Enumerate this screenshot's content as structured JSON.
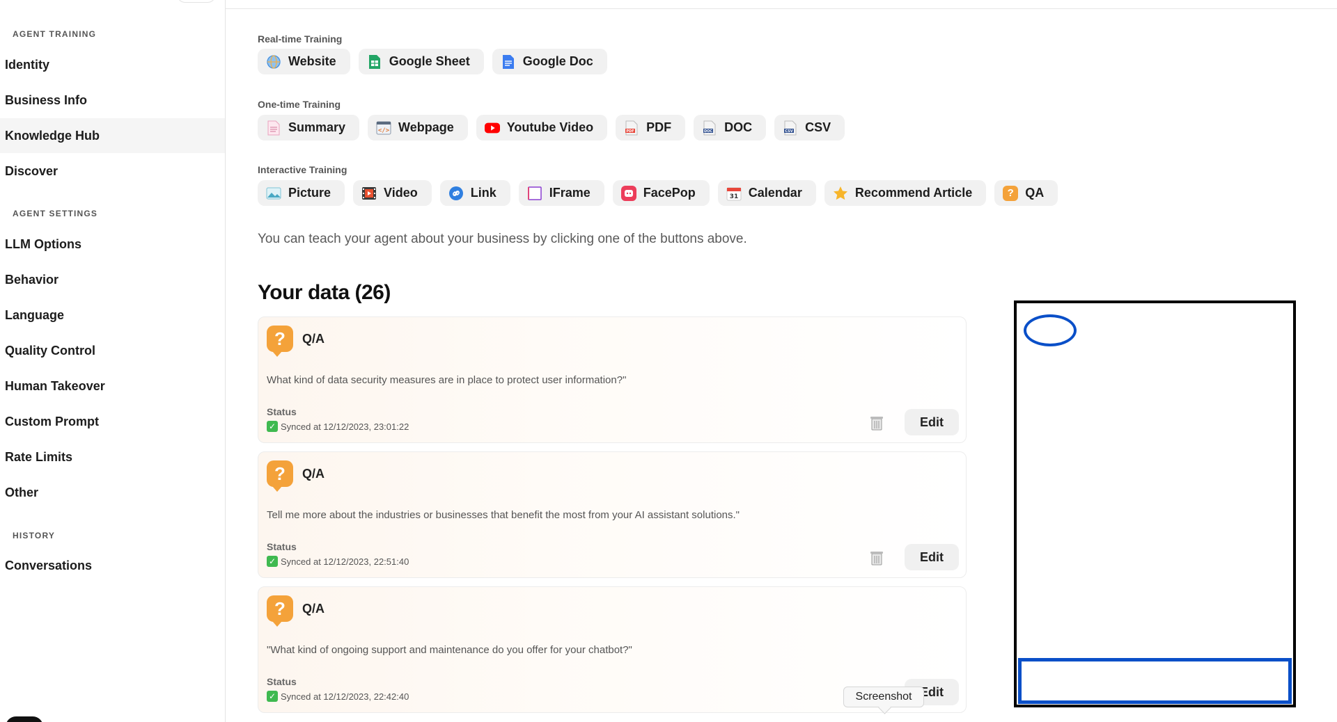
{
  "sidebar": {
    "sections": [
      {
        "title": "AGENT TRAINING",
        "items": [
          "Identity",
          "Business Info",
          "Knowledge Hub",
          "Discover"
        ]
      },
      {
        "title": "AGENT SETTINGS",
        "items": [
          "LLM Options",
          "Behavior",
          "Language",
          "Quality Control",
          "Human Takeover",
          "Custom Prompt",
          "Rate Limits",
          "Other"
        ]
      },
      {
        "title": "HISTORY",
        "items": [
          "Conversations"
        ]
      }
    ],
    "active_item": "Knowledge Hub"
  },
  "training": {
    "realtime": {
      "title": "Real-time Training",
      "chips": [
        {
          "label": "Website",
          "icon": "globe-icon"
        },
        {
          "label": "Google Sheet",
          "icon": "google-sheet-icon"
        },
        {
          "label": "Google Doc",
          "icon": "google-doc-icon"
        }
      ]
    },
    "onetime": {
      "title": "One-time Training",
      "chips": [
        {
          "label": "Summary",
          "icon": "summary-icon"
        },
        {
          "label": "Webpage",
          "icon": "webpage-code-icon"
        },
        {
          "label": "Youtube Video",
          "icon": "youtube-icon"
        },
        {
          "label": "PDF",
          "icon": "pdf-file-icon"
        },
        {
          "label": "DOC",
          "icon": "doc-file-icon"
        },
        {
          "label": "CSV",
          "icon": "csv-file-icon"
        }
      ]
    },
    "interactive": {
      "title": "Interactive Training",
      "chips": [
        {
          "label": "Picture",
          "icon": "picture-icon"
        },
        {
          "label": "Video",
          "icon": "film-icon"
        },
        {
          "label": "Link",
          "icon": "link-icon"
        },
        {
          "label": "IFrame",
          "icon": "iframe-icon"
        },
        {
          "label": "FacePop",
          "icon": "facepop-icon"
        },
        {
          "label": "Calendar",
          "icon": "calendar-icon"
        },
        {
          "label": "Recommend Article",
          "icon": "star-icon"
        },
        {
          "label": "QA",
          "icon": "qa-icon"
        }
      ]
    },
    "calendar_day": "31",
    "helper": "You can teach your agent about your business by clicking one of the buttons above."
  },
  "data": {
    "heading": "Your data (26)",
    "status_label": "Status",
    "edit_label": "Edit",
    "badge_glyph": "?",
    "check_glyph": "✓",
    "items": [
      {
        "type": "Q/A",
        "question": "What kind of data security measures are in place to protect user information?\"",
        "status": "Synced at 12/12/2023, 23:01:22"
      },
      {
        "type": "Q/A",
        "question": "Tell me more about the industries or businesses that benefit the most from your AI assistant solutions.\"",
        "status": "Synced at 12/12/2023, 22:51:40"
      },
      {
        "type": "Q/A",
        "question": "\"What kind of ongoing support and maintenance do you offer for your chatbot?\"",
        "status": "Synced at 12/12/2023, 22:42:40"
      }
    ]
  },
  "tooltip": "Screenshot",
  "colors": {
    "accent_orange": "#f4a23a",
    "widget_blue": "#0a4fc8",
    "synced_green": "#3fb950"
  }
}
